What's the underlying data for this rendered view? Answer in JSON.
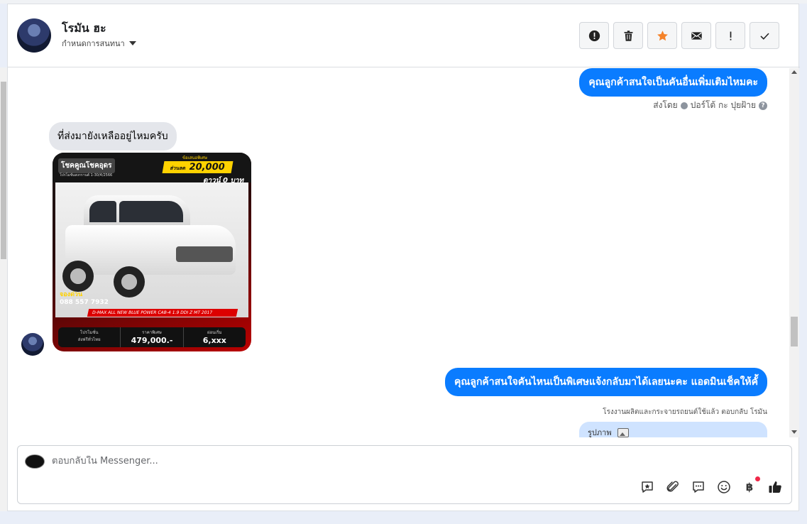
{
  "header": {
    "contact_name": "โรมัน ฮะ",
    "settings_label": "กำหนดการสนทนา",
    "actions": [
      {
        "name": "report-icon"
      },
      {
        "name": "trash-icon"
      },
      {
        "name": "star-icon",
        "color": "#f5832a"
      },
      {
        "name": "mail-icon"
      },
      {
        "name": "exclamation-icon"
      },
      {
        "name": "checkmark-icon"
      }
    ]
  },
  "messages": {
    "out1": "คุณลูกค้าสนใจเป็นคันอื่นเพิ่มเติมไหมคะ",
    "sent_by_prefix": "ส่งโดย",
    "sent_by_name": "ปอร์โต้ กะ ปุยฝ้าย",
    "in1": "ที่ส่งมายังเหลืออยู่ไหมครับ",
    "out2": "คุณลูกค้าสนใจคันไหนเป็นพิเศษแจ้งกลับมาได้เลยนะคะ แอดมินเช็คให้คั้",
    "reply_note": "โรงงานผลิตและกระจายรถยนต์ใช้แล้ว ตอบกลับ โรมัน",
    "photo_label": "รูปภาพ"
  },
  "car_ad": {
    "tag": "โชคคูณโชคอุดร",
    "promo_dates": "โปรโมชั่นสงกรานต์ 1-30/4/2566",
    "promo_label": "ข้อเสนอพิเศษ",
    "discount_prefix": "ส่วนลด",
    "discount": "20,000",
    "down": "ดาวน์ 0 บาท",
    "hotline_label": "จองด่วน",
    "phone": "088 557 7932",
    "model": "D-MAX ALL NEW BLUE POWER CAB-4 1.9 DDI Z MT 2017",
    "promo_cell_label": "โปรโมชั่น",
    "promo_cell_value": "ส่งฟรีทั่วไทย",
    "price_label": "ราคาพิเศษ",
    "price": "479,000.-",
    "installment_label": "ผ่อนเริ่ม",
    "installment": "6,xxx"
  },
  "composer": {
    "placeholder": "ตอบกลับใน Messenger...",
    "icons": [
      "saved-reply-icon",
      "attachment-icon",
      "chat-bubble-icon",
      "emoji-icon",
      "baht-payment-icon",
      "thumbs-up-icon"
    ],
    "baht_symbol": "฿"
  },
  "colors": {
    "outgoing_bubble": "#0a7cff",
    "incoming_bubble": "#e4e6eb",
    "star": "#f5832a"
  }
}
